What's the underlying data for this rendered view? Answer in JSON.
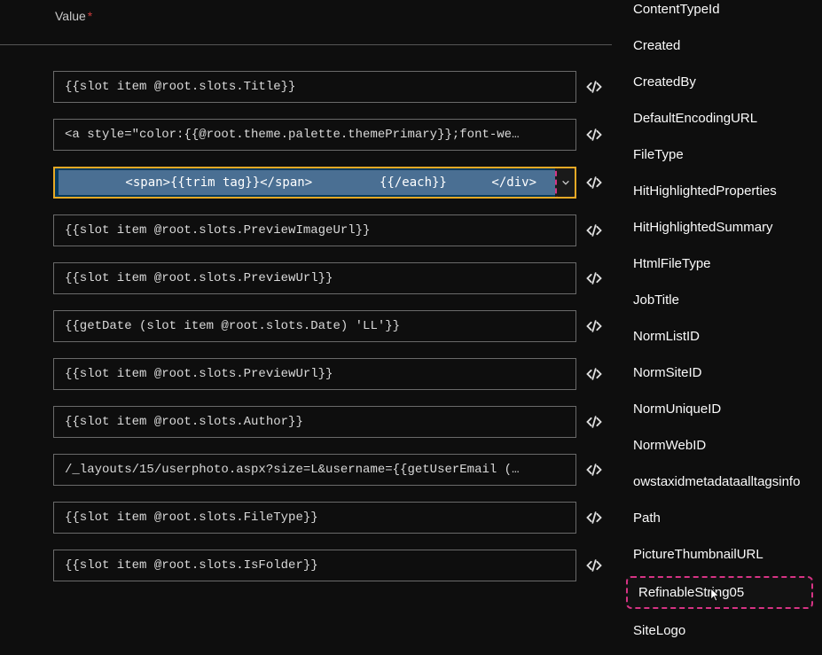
{
  "label": "Value",
  "rows": [
    {
      "value": "{{slot item @root.slots.Title}}",
      "selected": false
    },
    {
      "value": "<a style=\"color:{{@root.theme.palette.themePrimary}};font-we…",
      "selected": false
    },
    {
      "value": "        <span>{{trim tag}}</span>         {{/each}}      </div>    </div>{{/if}}",
      "selected": true
    },
    {
      "value": "{{slot item @root.slots.PreviewImageUrl}}",
      "selected": false
    },
    {
      "value": "{{slot item @root.slots.PreviewUrl}}",
      "selected": false
    },
    {
      "value": "{{getDate (slot item @root.slots.Date) 'LL'}}",
      "selected": false
    },
    {
      "value": "{{slot item @root.slots.PreviewUrl}}",
      "selected": false
    },
    {
      "value": "{{slot item @root.slots.Author}}",
      "selected": false
    },
    {
      "value": "/_layouts/15/userphoto.aspx?size=L&username={{getUserEmail (…",
      "selected": false
    },
    {
      "value": "{{slot item @root.slots.FileType}}",
      "selected": false
    },
    {
      "value": "{{slot item @root.slots.IsFolder}}",
      "selected": false
    }
  ],
  "properties": [
    {
      "label": "ContentTypeId",
      "highlighted": false
    },
    {
      "label": "Created",
      "highlighted": false
    },
    {
      "label": "CreatedBy",
      "highlighted": false
    },
    {
      "label": "DefaultEncodingURL",
      "highlighted": false
    },
    {
      "label": "FileType",
      "highlighted": false
    },
    {
      "label": "HitHighlightedProperties",
      "highlighted": false
    },
    {
      "label": "HitHighlightedSummary",
      "highlighted": false
    },
    {
      "label": "HtmlFileType",
      "highlighted": false
    },
    {
      "label": "JobTitle",
      "highlighted": false
    },
    {
      "label": "NormListID",
      "highlighted": false
    },
    {
      "label": "NormSiteID",
      "highlighted": false
    },
    {
      "label": "NormUniqueID",
      "highlighted": false
    },
    {
      "label": "NormWebID",
      "highlighted": false
    },
    {
      "label": "owstaxidmetadataalltagsinfo",
      "highlighted": false
    },
    {
      "label": "Path",
      "highlighted": false
    },
    {
      "label": "PictureThumbnailURL",
      "highlighted": false
    },
    {
      "label": "RefinableString05",
      "highlighted": true
    },
    {
      "label": "SiteLogo",
      "highlighted": false
    }
  ]
}
